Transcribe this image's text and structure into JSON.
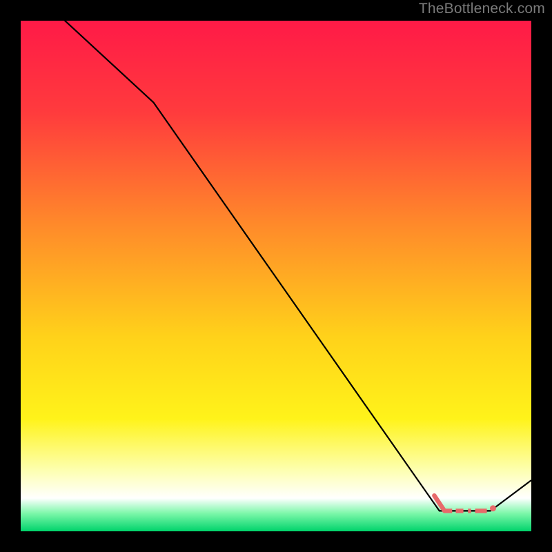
{
  "attribution": "TheBottleneck.com",
  "chart_data": {
    "type": "line",
    "title": "",
    "xlabel": "",
    "ylabel": "",
    "xlim": [
      0,
      100
    ],
    "ylim": [
      0,
      100
    ],
    "background_gradient": {
      "stops": [
        {
          "pos": 0.0,
          "color": "#ff1a47"
        },
        {
          "pos": 0.18,
          "color": "#ff3b3d"
        },
        {
          "pos": 0.4,
          "color": "#ff8a2a"
        },
        {
          "pos": 0.62,
          "color": "#ffd21a"
        },
        {
          "pos": 0.78,
          "color": "#fff31a"
        },
        {
          "pos": 0.88,
          "color": "#fdffb0"
        },
        {
          "pos": 0.935,
          "color": "#ffffff"
        },
        {
          "pos": 0.965,
          "color": "#7cf7a9"
        },
        {
          "pos": 1.0,
          "color": "#00d36b"
        }
      ]
    },
    "series": [
      {
        "name": "bottleneck-curve",
        "color": "#000000",
        "width": 2.2,
        "points": [
          {
            "x": 0,
            "y": 108
          },
          {
            "x": 26,
            "y": 84
          },
          {
            "x": 82,
            "y": 4
          },
          {
            "x": 92,
            "y": 4
          },
          {
            "x": 100,
            "y": 10
          }
        ]
      }
    ],
    "optimal_band": {
      "name": "optimal-range",
      "color": "#e86a6a",
      "segments": [
        {
          "x0": 81,
          "y0": 7,
          "x1": 83,
          "y1": 4,
          "cap": "round",
          "w": 6.5
        },
        {
          "x0": 83,
          "y0": 4,
          "x1": 84.5,
          "y1": 4,
          "cap": "butt",
          "w": 6.5
        },
        {
          "x0": 85.2,
          "y0": 4,
          "x1": 86.7,
          "y1": 4,
          "cap": "butt",
          "w": 6.5
        },
        {
          "x0": 87.6,
          "y0": 4,
          "x1": 88.2,
          "y1": 4,
          "cap": "butt",
          "w": 6.5
        },
        {
          "x0": 89.0,
          "y0": 4,
          "x1": 91.3,
          "y1": 4,
          "cap": "butt",
          "w": 6.5
        },
        {
          "x0": 92.5,
          "y0": 4.5,
          "x1": 92.5,
          "y1": 4.5,
          "cap": "round",
          "w": 9
        }
      ]
    }
  }
}
